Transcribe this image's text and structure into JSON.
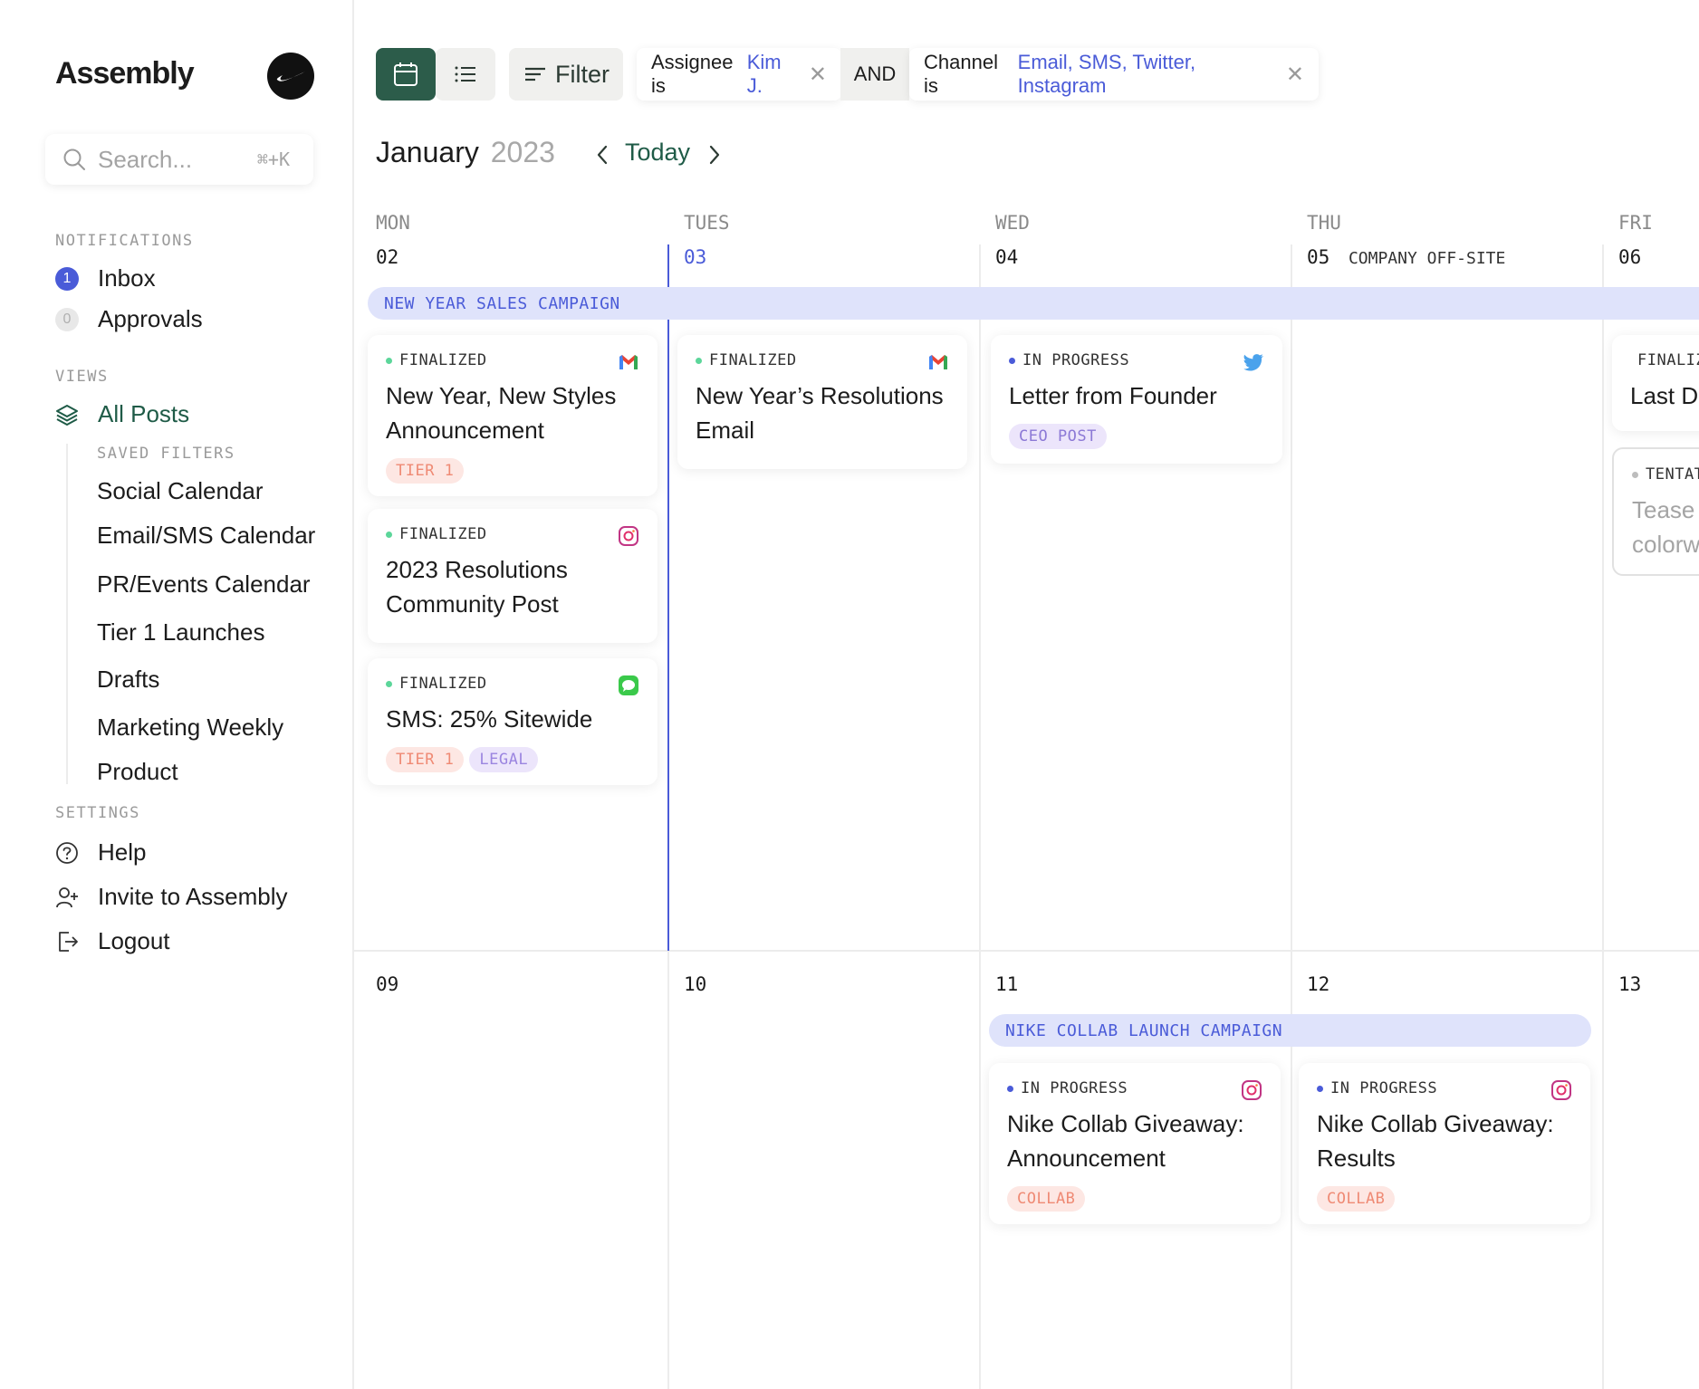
{
  "sidebar": {
    "brand": "Assembly",
    "search": {
      "placeholder": "Search...",
      "shortcut": "⌘+K"
    },
    "notifications_label": "NOTIFICATIONS",
    "inbox": {
      "label": "Inbox",
      "count": "1"
    },
    "approvals": {
      "label": "Approvals",
      "count": "0"
    },
    "views_label": "VIEWS",
    "all_posts": "All Posts",
    "saved_filters_label": "SAVED FILTERS",
    "saved_filters": [
      "Social Calendar",
      "Email/SMS Calendar",
      "PR/Events Calendar",
      "Tier 1 Launches",
      "Drafts",
      "Marketing Weekly",
      "Product"
    ],
    "settings_label": "SETTINGS",
    "help": "Help",
    "invite": "Invite to Assembly",
    "logout": "Logout"
  },
  "toolbar": {
    "filter_label": "Filter",
    "assignee_chip": {
      "prefix": "Assignee is",
      "value": "Kim J."
    },
    "and_label": "AND",
    "channel_chip": {
      "prefix": "Channel is",
      "value": "Email, SMS, Twitter, Instagram"
    }
  },
  "calendar": {
    "month": "January",
    "year": "2023",
    "today_label": "Today",
    "day_names": [
      "MON",
      "TUES",
      "WED",
      "THU",
      "FRI"
    ],
    "week1": {
      "dates": [
        "02",
        "03",
        "04",
        "05",
        "06"
      ],
      "event_note": "COMPANY OFF-SITE",
      "campaign": "NEW YEAR SALES CAMPAIGN",
      "cards": [
        {
          "status": "FINALIZED",
          "title": "New Year, New Styles Announcement",
          "tags": [
            "TIER 1"
          ],
          "icon": "gmail-icon"
        },
        {
          "status": "FINALIZED",
          "title": "2023 Resolutions Community Post",
          "tags": [],
          "icon": "instagram-icon"
        },
        {
          "status": "FINALIZED",
          "title": "SMS: 25% Sitewide",
          "tags": [
            "TIER 1",
            "LEGAL"
          ],
          "icon": "messages-icon"
        },
        {
          "status": "FINALIZED",
          "title": "New Year’s Resolutions Email",
          "tags": [],
          "icon": "gmail-icon"
        },
        {
          "status": "IN PROGRESS",
          "title": "Letter from Founder",
          "tags": [
            "CEO POST"
          ],
          "icon": "twitter-icon"
        },
        {
          "status": "FINALIZED",
          "title": "Last D",
          "tags": []
        },
        {
          "status": "TENTAT",
          "title": "Tease colorw",
          "tags": []
        }
      ]
    },
    "week2": {
      "dates": [
        "09",
        "10",
        "11",
        "12",
        "13"
      ],
      "campaign": "NIKE COLLAB LAUNCH CAMPAIGN",
      "cards": [
        {
          "status": "IN PROGRESS",
          "title": "Nike Collab Giveaway: Announcement",
          "tags": [
            "COLLAB"
          ],
          "icon": "instagram-icon"
        },
        {
          "status": "IN PROGRESS",
          "title": "Nike Collab Giveaway: Results",
          "tags": [
            "COLLAB"
          ],
          "icon": "instagram-icon"
        }
      ]
    }
  },
  "colors": {
    "accent_green": "#2c5c4a",
    "accent_blue": "#4a5bd8",
    "campaign_bg": "#dfe3fb"
  }
}
